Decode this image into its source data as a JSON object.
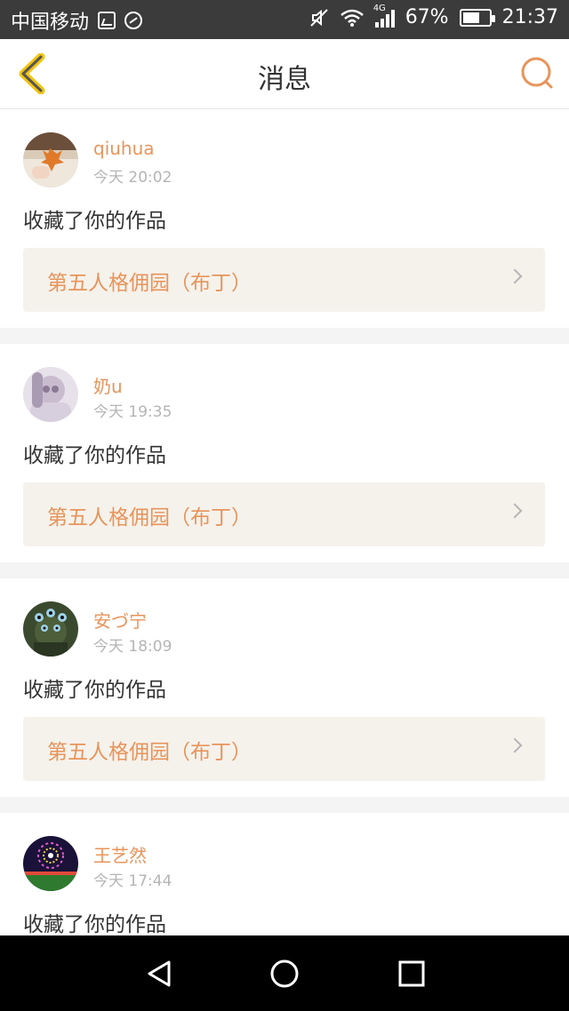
{
  "status_bar": {
    "carrier": "中国移动",
    "network": "4G",
    "battery": "67%",
    "battery_level": 0.67,
    "time": "21:37",
    "icons": [
      "gallery-icon",
      "sync-icon",
      "mute-icon",
      "wifi-icon",
      "signal-icon",
      "battery-icon"
    ]
  },
  "header": {
    "title": "消息",
    "back_icon": "chevron-left-icon",
    "search_icon": "search-icon"
  },
  "colors": {
    "accent": "#e8945a",
    "back_icon": "#f1c40f"
  },
  "messages": [
    {
      "user": "qiuhua",
      "time": "今天 20:02",
      "action": "收藏了你的作品",
      "work": "第五人格佣园（布丁）",
      "avatar": "maple-leaf-avatar"
    },
    {
      "user": "奶u",
      "time": "今天 19:35",
      "action": "收藏了你的作品",
      "work": "第五人格佣园（布丁）",
      "avatar": "girl-avatar"
    },
    {
      "user": "安づ宁",
      "time": "今天 18:09",
      "action": "收藏了你的作品",
      "work": "第五人格佣园（布丁）",
      "avatar": "multi-eye-avatar"
    },
    {
      "user": "王艺然",
      "time": "今天 17:44",
      "action": "收藏了你的作品",
      "work": "",
      "avatar": "fireworks-avatar"
    }
  ],
  "nav_bar": {
    "icons": [
      "back-triangle-icon",
      "home-circle-icon",
      "recents-square-icon"
    ]
  }
}
